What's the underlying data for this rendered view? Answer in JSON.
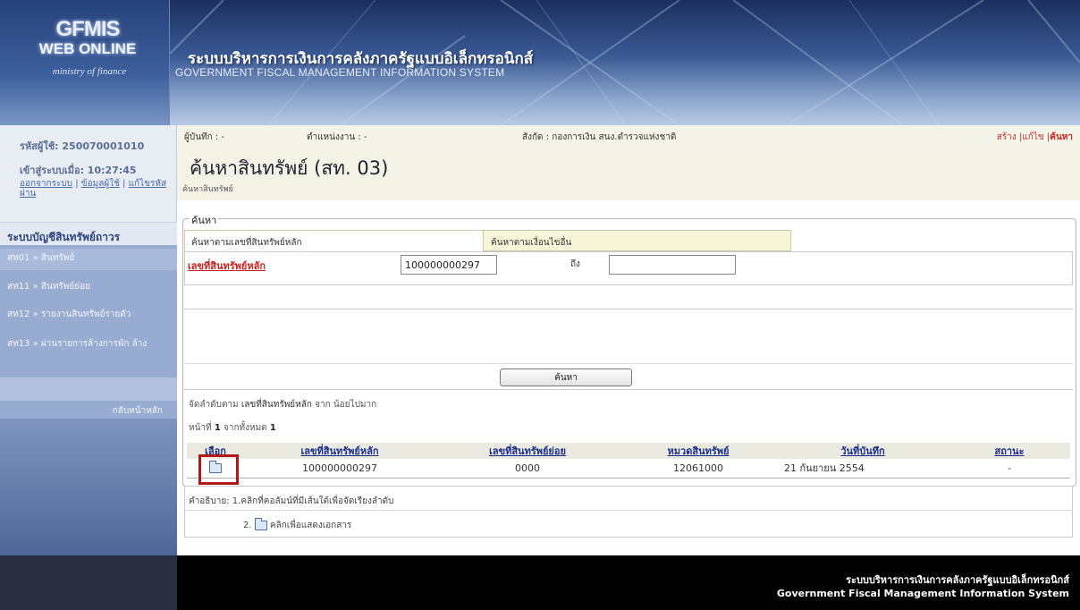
{
  "header": {
    "logo_main": "GFMIS",
    "logo_sub": "WEB ONLINE",
    "logo_tag": "ministry of finance",
    "title_th": "ระบบบริหารการเงินการคลังภาครัฐแบบอิเล็กทรอนิกส์",
    "title_en": "GOVERNMENT FISCAL MANAGEMENT INFORMATION SYSTEM"
  },
  "sidebar": {
    "user_id": "รหัสผู้ใช้: 250070001010",
    "login_time": "เข้าสู่ระบบเมื่อ: 10:27:45",
    "links": [
      "ออกจากระบบ",
      "ข้อมูลผู้ใช้",
      "แก้ไขรหัสผ่าน"
    ],
    "menu_title": "ระบบบัญชีสินทรัพย์ถาวร",
    "items": [
      {
        "label": "สท01 » สินทรัพย์"
      },
      {
        "label": "สท11 » สินทรัพย์ย่อย"
      },
      {
        "label": "สท12 » รายงานสินทรัพย์รายตัว"
      },
      {
        "label": "สท13 » ผ่านรายการล้างการพัก ล้าง"
      }
    ],
    "back_main": "กลับหน้าหลัก"
  },
  "infobar": {
    "recorder": "ผู้บันทึก : -",
    "position": "ตำแหน่งงาน : -",
    "department": "สังกัด : กองการเงิน สนง.ตำรวจแห่งชาติ",
    "actions": [
      "สร้าง",
      "แก้ไข",
      "ค้นหา"
    ]
  },
  "page": {
    "title": "ค้นหาสินทรัพย์ (สท. 03)",
    "subtitle": "ค้นหาสินทรัพย์"
  },
  "search": {
    "legend": "ค้นหา",
    "tab_main": "ค้นหาตามเลขที่สินทรัพย์หลัก",
    "tab_other": "ค้นหาตามเงื่อนไขอื่น",
    "asset_label": "เลขที่สินทรัพย์หลัก",
    "from_value": "100000000297",
    "to_label": "ถึง",
    "to_value": "",
    "button": "ค้นหา"
  },
  "results": {
    "sort_prefix": "จัดลำดับตาม",
    "sort_field": "เลขที่สินทรัพย์หลัก",
    "sort_order": "จาก น้อยไปมาก",
    "page_prefix": "หน้าที่",
    "page_current": "1",
    "page_mid": "จากทั้งหมด",
    "page_total": "1",
    "columns": [
      "เลือก",
      "เลขที่สินทรัพย์หลัก",
      "เลขที่สินทรัพย์ย่อย",
      "หมวดสินทรัพย์",
      "วันที่บันทึก",
      "สถานะ"
    ],
    "rows": [
      {
        "main_no": "100000000297",
        "sub_no": "0000",
        "category": "12061000",
        "date": "21 กันยายน 2554",
        "status": "-"
      }
    ]
  },
  "legend": {
    "prefix": "คำอธิบาย:",
    "line1": "1.คลิกที่คอลัมน์ที่มีเส้นใต้เพื่อจัดเรียงลำดับ",
    "line2_num": "2.",
    "line2": "คลิกเพื่อแสดงเอกสาร"
  },
  "footer": {
    "th": "ระบบบริหารการเงินการคลังภาครัฐแบบอิเล็กทรอนิกส์",
    "en": "Government Fiscal Management Information System"
  }
}
